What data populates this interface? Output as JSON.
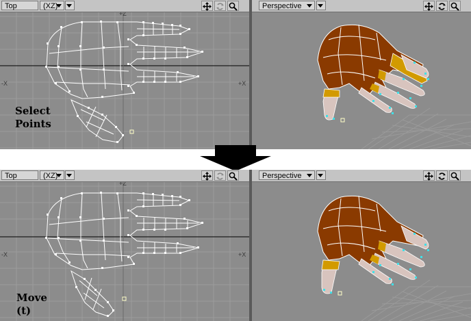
{
  "panels": [
    {
      "caption_line1": "Select",
      "caption_line2": "Points",
      "left_viewport": {
        "view": "Top",
        "axis": "(XZ)"
      },
      "right_viewport": {
        "view": "Perspective"
      }
    },
    {
      "caption_line1": "Move",
      "caption_line2": "(t)",
      "left_viewport": {
        "view": "Top",
        "axis": "(XZ)"
      },
      "right_viewport": {
        "view": "Perspective"
      }
    }
  ],
  "axis_labels": {
    "plus_z": "+Z",
    "minus_x": "-X",
    "plus_x": "+X"
  },
  "icons": [
    "move-icon",
    "rotate-icon",
    "zoom-icon",
    "dropdown-arrow-icon",
    "down-arrow-icon"
  ],
  "colors": {
    "viewport_bg": "#8c8c8c",
    "toolbar_bg": "#c4c4c4",
    "hand_skin": "#8a3a00",
    "band": "#d29a00",
    "fingertip": "#d8c4be",
    "selected_point": "#40e0e8"
  }
}
